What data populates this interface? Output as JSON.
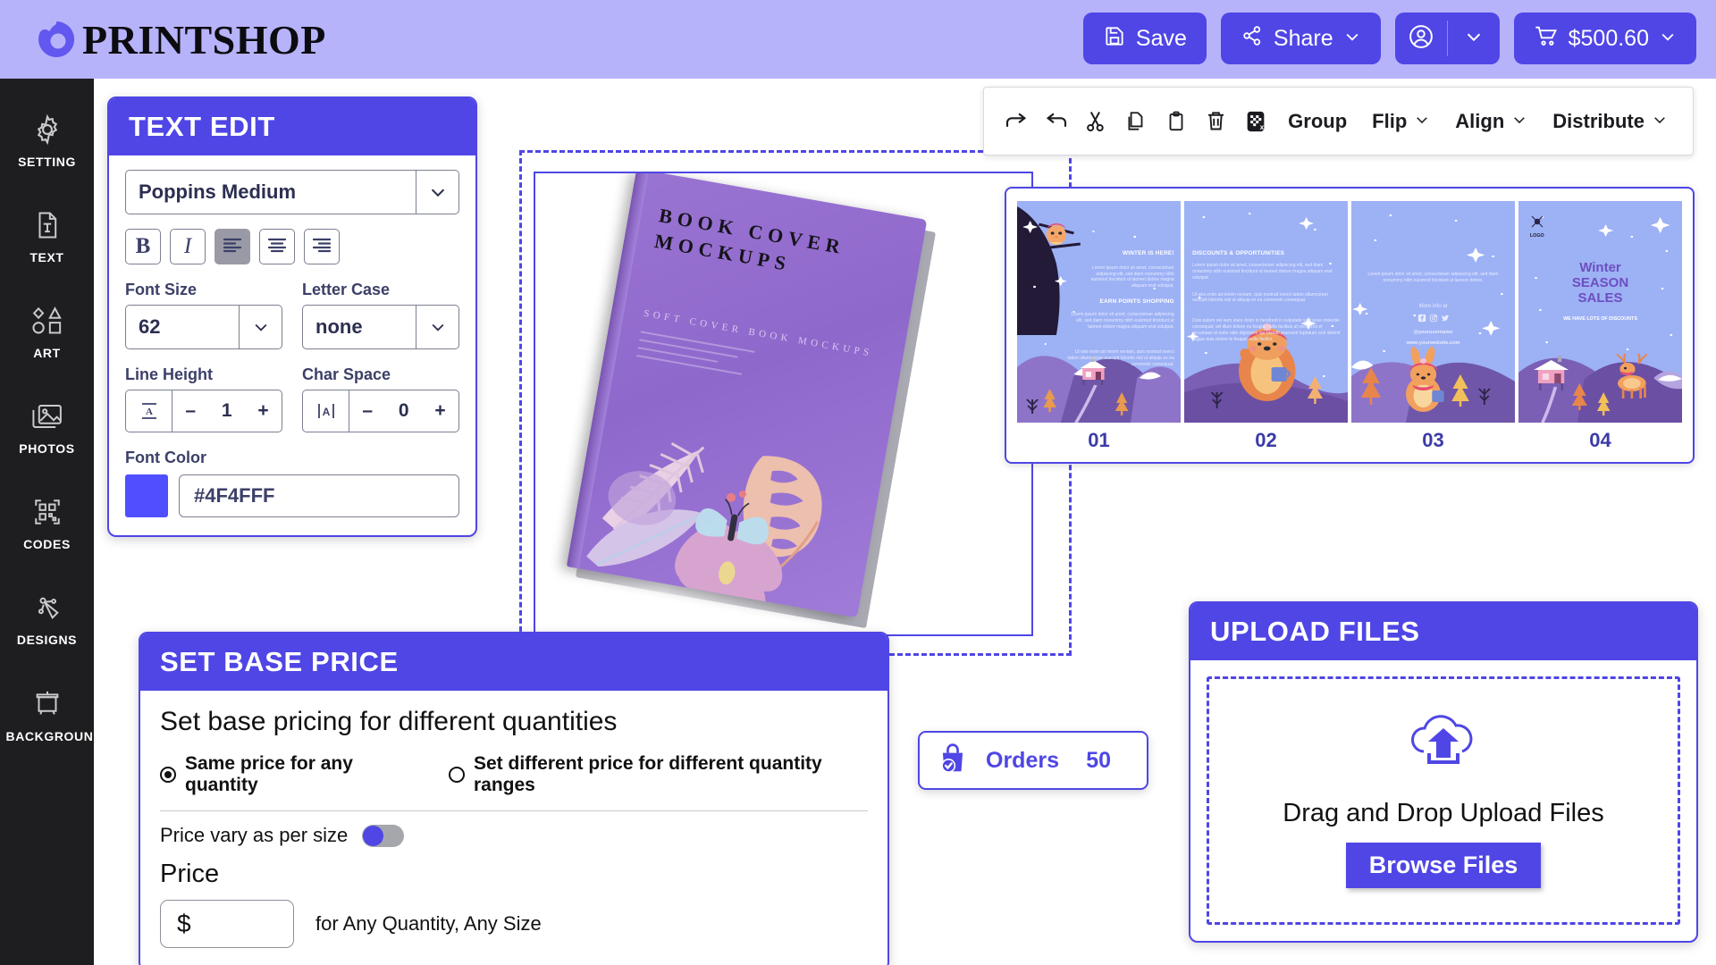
{
  "header": {
    "logo_text": "PRINTSHOP",
    "logo_icon": "circle-swirl-icon",
    "save_label": "Save",
    "share_label": "Share",
    "cart_amount": "$500.60",
    "account_icon": "user-circle-icon",
    "cart_icon": "shopping-cart-icon",
    "save_icon": "floppy-disk-icon",
    "share_icon": "share-nodes-icon",
    "brand_purple": "#4f46e5",
    "header_bg": "#b7b3fb"
  },
  "sidebar": {
    "items": [
      {
        "label": "SETTING",
        "icon": "gear-icon"
      },
      {
        "label": "TEXT",
        "icon": "text-document-icon"
      },
      {
        "label": "ART",
        "icon": "shapes-icon"
      },
      {
        "label": "PHOTOS",
        "icon": "photos-icon"
      },
      {
        "label": "CODES",
        "icon": "qr-code-icon"
      },
      {
        "label": "DESIGNS",
        "icon": "pen-tool-icon"
      },
      {
        "label": "BACKGROUND",
        "icon": "backdrop-icon"
      }
    ]
  },
  "text_edit": {
    "title": "TEXT EDIT",
    "font_family_value": "Poppins Medium",
    "format_buttons": [
      {
        "name": "bold",
        "label": "B",
        "active": false
      },
      {
        "name": "italic",
        "label": "I",
        "active": false
      },
      {
        "name": "align-left",
        "label": "",
        "active": true
      },
      {
        "name": "align-center",
        "label": "",
        "active": false
      },
      {
        "name": "align-right",
        "label": "",
        "active": false
      }
    ],
    "font_size_label": "Font Size",
    "font_size_value": "62",
    "letter_case_label": "Letter Case",
    "letter_case_value": "none",
    "line_height_label": "Line Height",
    "line_height_value": "1",
    "char_space_label": "Char Space",
    "char_space_value": "0",
    "minus": "–",
    "plus": "+",
    "font_color_label": "Font Color",
    "font_color_value": "#4F4FFF"
  },
  "toolbar": {
    "icons": [
      {
        "name": "redo-icon"
      },
      {
        "name": "undo-icon"
      },
      {
        "name": "cut-scissors-icon"
      },
      {
        "name": "copy-icon"
      },
      {
        "name": "paste-icon"
      },
      {
        "name": "delete-trash-icon"
      },
      {
        "name": "transparency-remove-bg-icon"
      }
    ],
    "group_label": "Group",
    "flip_label": "Flip",
    "align_label": "Align",
    "distribute_label": "Distribute"
  },
  "canvas": {
    "book_title": "BOOK COVER MOCKUPS",
    "book_subtitle": "SOFT COVER BOOK MOCKUPS"
  },
  "thumbnails": {
    "items": [
      {
        "number": "01",
        "heading_1": "WINTER IS HERE!",
        "body_1": "Lorem ipsum dolor sit amet, consectetuer adipiscing elit, sed diam nonummy nibh euismod tincidunt ut laoreet dolore magna aliquam erat volutpat.",
        "heading_2": "EARN POINTS SHOPPING",
        "body_2": "Lorem ipsum dolor sit amet, consectetuer adipiscing elit, sed diam nonummy nibh euismod tincidunt ut laoreet dolore magna aliquam erat volutpat.",
        "body_3": "Ut wisi enim ad minim veniam, quis nostrud exerci tation ullamcorper suscipit lobortis nisl ut aliquip ex ea commodo consequat."
      },
      {
        "number": "02",
        "heading_1": "DISCOUNTS & OPPORTUNITIES",
        "body_1": "Lorem ipsum dolor sit amet, consectetuer adipiscing elit, sed diam nonummy nibh euismod tincidunt ut laoreet dolore magna aliquam erat volutpat.",
        "body_2": "Ut wisi enim ad minim veniam, quis nostrud exerci tation ullamcorper suscipit lobortis nisl ut aliquip ex ea commodo consequat.",
        "body_3": "Duis autem vel eum iriure dolor in hendrerit in vulputate velit esse molestie consequat, vel illum dolore eu feugiat nulla facilisis at vero eros et accumsan et iusto odio dignissim qui blandit praesent luptatum zzril delenit augue duis dolore te feugait nulla facilisi."
      },
      {
        "number": "03",
        "body_1": "Lorem ipsum dolor sit amet, consectetuer adipiscing elit, sed diam nonummy nibh euismod tincidunt ut laoreet dolore.",
        "more_info": "More info at",
        "social_icons": "facebook-instagram-twitter-icons",
        "username": "@yourusername",
        "website": "www.yourwebsite.com"
      },
      {
        "number": "04",
        "logo_label": "LOGO",
        "title_line_1": "Winter",
        "title_line_2": "SEASON",
        "title_line_3": "SALES",
        "tagline": "WE HAVE LOTS OF DISCOUNTS"
      }
    ]
  },
  "base_price": {
    "title": "SET BASE PRICE",
    "subtitle": "Set base pricing for different quantities",
    "option_same": "Same price for any quantity",
    "option_different": "Set different price for different quantity ranges",
    "selected_option": "same",
    "vary_label": "Price vary as per size",
    "vary_on": false,
    "price_label": "Price",
    "price_value": "$",
    "price_suffix": "for Any Quantity, Any Size"
  },
  "orders": {
    "label": "Orders",
    "count": "50",
    "icon": "shopping-bag-check-icon"
  },
  "upload": {
    "title": "UPLOAD FILES",
    "dropzone_text": "Drag and Drop Upload Files",
    "browse_label": "Browse Files",
    "icon": "cloud-upload-icon"
  }
}
